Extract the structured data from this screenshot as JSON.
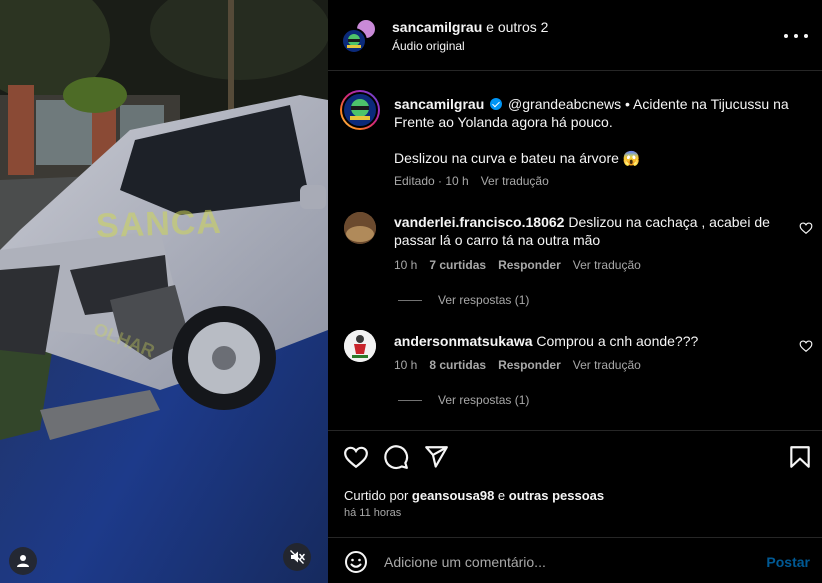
{
  "media": {
    "watermark_top": "SANCA",
    "watermark_bottom": "OLHAR",
    "user_icon": "user-icon",
    "mute_icon": "speaker-muted-icon"
  },
  "header": {
    "username": "sancamilgrau",
    "title_suffix": " e outros 2",
    "audio": "Áudio original",
    "more_icon": "more-horizontal-icon"
  },
  "caption": {
    "username": "sancamilgrau",
    "text": "@grandeabcnews • Acidente na Tijucussu na Frente ao Yolanda agora há pouco.",
    "text2": "Deslizou na curva e bateu na árvore 😱",
    "edited": "Editado · 10 h",
    "translate": "Ver tradução"
  },
  "comments": [
    {
      "username": "vanderlei.francisco.18062",
      "text": "Deslizou na cachaça , acabei de passar lá o carro tá na outra mão",
      "time": "10 h",
      "likes": "7 curtidas",
      "reply": "Responder",
      "translate": "Ver tradução",
      "replies": "Ver respostas (1)"
    },
    {
      "username": "andersonmatsukawa",
      "text": "Comprou a cnh aonde???",
      "time": "10 h",
      "likes": "8 curtidas",
      "reply": "Responder",
      "translate": "Ver tradução",
      "replies": "Ver respostas (1)"
    }
  ],
  "actions": {
    "like_icon": "heart-icon",
    "comment_icon": "comment-icon",
    "share_icon": "send-icon",
    "save_icon": "bookmark-icon"
  },
  "likes": {
    "prefix": "Curtido por ",
    "user": "geansousa98",
    "middle": " e ",
    "others": "outras pessoas"
  },
  "time_ago": "há 11 horas",
  "comment_box": {
    "emoji_icon": "emoji-icon",
    "placeholder": "Adicione um comentário...",
    "post": "Postar"
  },
  "colors": {
    "background": "#000000",
    "text": "#f5f5f5",
    "secondary": "#a8a8a8",
    "link": "#0095f6",
    "divider": "#262626"
  }
}
